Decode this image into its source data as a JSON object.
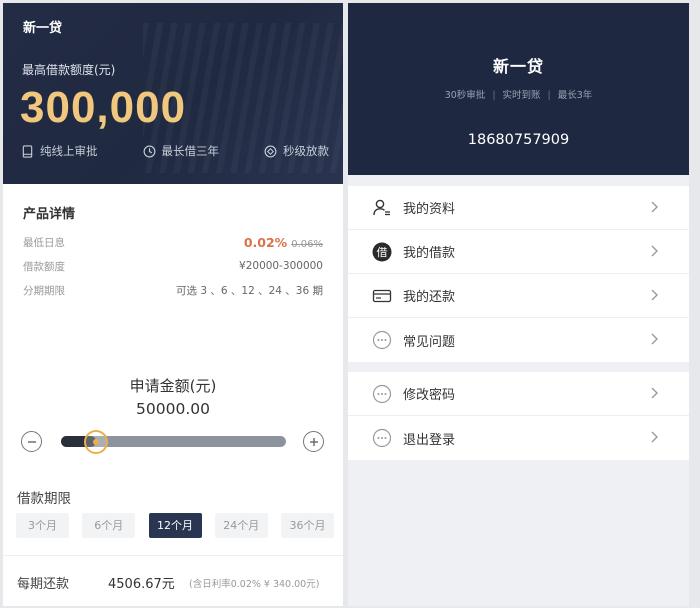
{
  "left": {
    "app_name": "新一贷",
    "limit_label": "最高借款额度(元)",
    "limit_amount": "300,000",
    "features": [
      {
        "icon": "tablet-icon",
        "label": "纯线上审批"
      },
      {
        "icon": "clock-icon",
        "label": "最长借三年"
      },
      {
        "icon": "diamond-icon",
        "label": "秒级放款"
      }
    ],
    "detail": {
      "title": "产品详情",
      "rows": [
        {
          "label": "最低日息",
          "rate": "0.02%",
          "old_rate": "0.06%"
        },
        {
          "label": "借款额度",
          "value": "¥20000-300000"
        },
        {
          "label": "分期期限",
          "value": "可选 3 、6 、12 、24 、36 期"
        }
      ]
    },
    "apply": {
      "label": "申请金额(元)",
      "value": "50000.00",
      "slider_fraction": 0.1
    },
    "term": {
      "label": "借款期限",
      "options": [
        "3个月",
        "6个月",
        "12个月",
        "24个月",
        "36个月"
      ],
      "selected_index": 2
    },
    "repayment": {
      "label": "每期还款",
      "value": "4506.67元",
      "note": "(含日利率0.02% ¥ 340.00元)"
    }
  },
  "right": {
    "title": "新一贷",
    "tags": [
      "30秒审批",
      "实时到账",
      "最长3年"
    ],
    "phone": "18680757909",
    "menu_group1": [
      {
        "icon": "user-profile-icon",
        "label": "我的资料"
      },
      {
        "icon": "loan-badge-icon",
        "label": "我的借款",
        "badge_char": "借"
      },
      {
        "icon": "card-icon",
        "label": "我的还款"
      },
      {
        "icon": "more-dots-icon",
        "label": "常见问题"
      }
    ],
    "menu_group2": [
      {
        "icon": "more-dots-icon",
        "label": "修改密码"
      },
      {
        "icon": "more-dots-icon",
        "label": "退出登录"
      }
    ]
  },
  "colors": {
    "hero_bg": "#1f2940",
    "gold": "#f0c77c",
    "rate_orange": "#d9734b",
    "active_term": "#2a3552"
  }
}
